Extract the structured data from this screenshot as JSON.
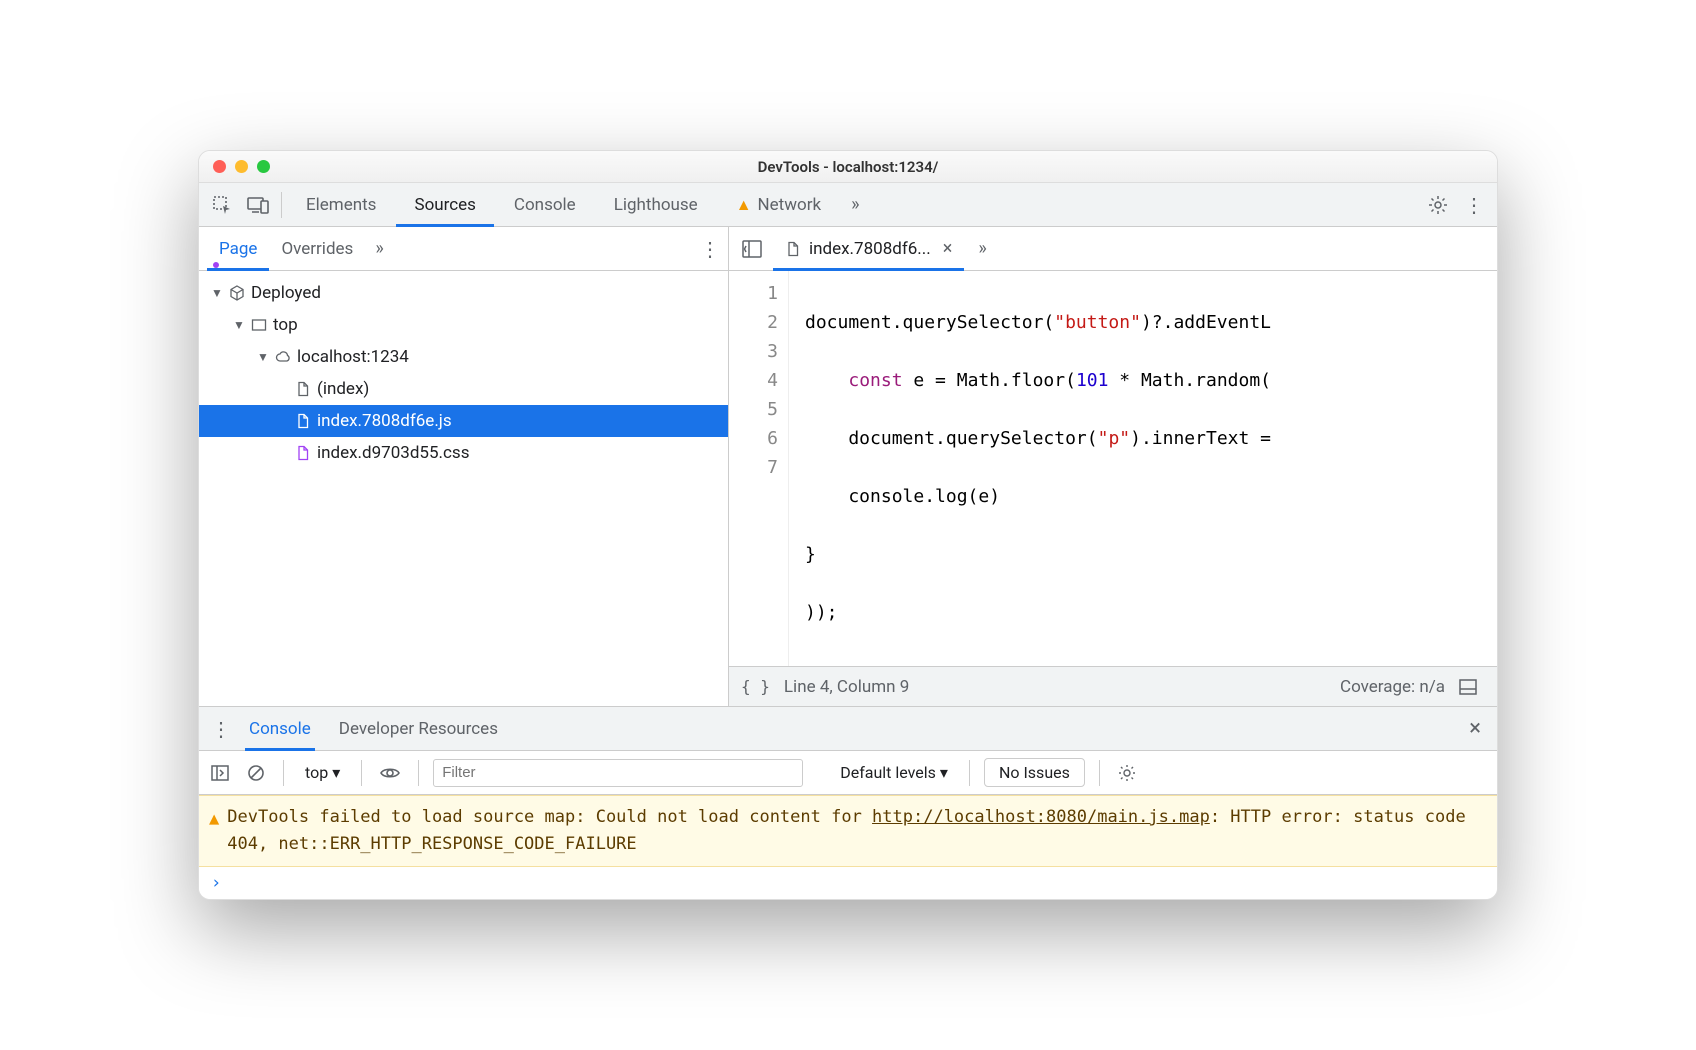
{
  "window": {
    "title": "DevTools - localhost:1234/"
  },
  "main_tabs": {
    "elements": "Elements",
    "sources": "Sources",
    "console": "Console",
    "lighthouse": "Lighthouse",
    "network": "Network"
  },
  "sidebar_tabs": {
    "page": "Page",
    "overrides": "Overrides"
  },
  "tree": {
    "deployed": "Deployed",
    "top": "top",
    "host": "localhost:1234",
    "index": "(index)",
    "js": "index.7808df6e.js",
    "css": "index.d9703d55.css"
  },
  "file_tab": {
    "name": "index.7808df6..."
  },
  "editor": {
    "lines": [
      "1",
      "2",
      "3",
      "4",
      "5",
      "6",
      "7"
    ]
  },
  "code": {
    "l1a": "document.querySelector(",
    "l1s": "\"button\"",
    "l1b": ")?.addEventL",
    "l2a": "    ",
    "l2k": "const",
    "l2b": " e = Math.floor(",
    "l2n": "101",
    "l2c": " * Math.random(",
    "l3a": "    document.querySelector(",
    "l3s": "\"p\"",
    "l3b": ").innerText =",
    "l4": "    console.log(e)",
    "l5": "}",
    "l6": "));",
    "l7": ""
  },
  "status": {
    "pos": "Line 4, Column 9",
    "coverage": "Coverage: n/a"
  },
  "drawer_tabs": {
    "console": "Console",
    "devres": "Developer Resources"
  },
  "console_toolbar": {
    "context": "top",
    "filter_placeholder": "Filter",
    "levels": "Default levels",
    "issues": "No Issues"
  },
  "warning": {
    "pre": "DevTools failed to load source map: Could not load content for ",
    "url": "http://localhost:8080/main.js.map",
    "post": ": HTTP error: status code 404, net::ERR_HTTP_RESPONSE_CODE_FAILURE"
  }
}
